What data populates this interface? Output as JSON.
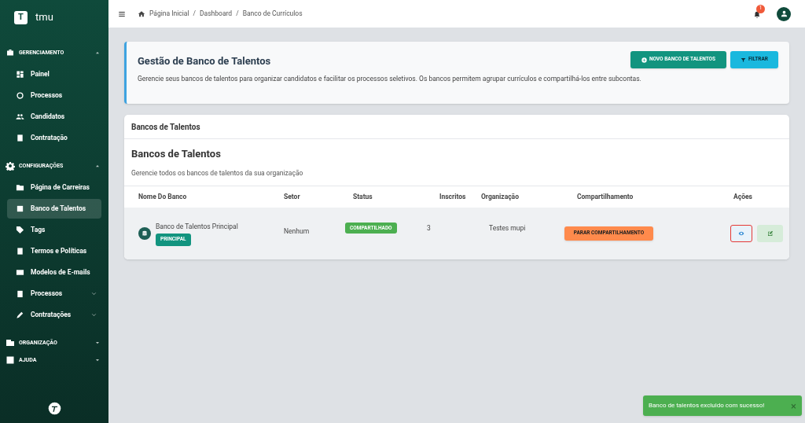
{
  "brand": {
    "logo_letter": "T",
    "name": "tmu"
  },
  "sidebar": {
    "sections": [
      {
        "label": "GERENCIAMENTO",
        "expanded": true,
        "items": [
          {
            "kind": "link",
            "label": "Painel",
            "selected": false
          },
          {
            "kind": "link",
            "label": "Processos",
            "selected": false
          },
          {
            "kind": "link",
            "label": "Candidatos",
            "selected": false
          },
          {
            "kind": "link",
            "label": "Contratação",
            "selected": false
          }
        ]
      },
      {
        "label": "CONFIGURAÇÕES",
        "expanded": true,
        "items": [
          {
            "kind": "link",
            "label": "Página de Carreiras",
            "selected": false
          },
          {
            "kind": "link",
            "label": "Banco de Talentos",
            "selected": true
          },
          {
            "kind": "link",
            "label": "Tags",
            "selected": false
          },
          {
            "kind": "link",
            "label": "Termos e Políticas",
            "selected": false
          },
          {
            "kind": "link",
            "label": "Modelos de E-mails",
            "selected": false
          },
          {
            "kind": "group",
            "label": "Processos",
            "selected": false,
            "expanded": false
          },
          {
            "kind": "group",
            "label": "Contratações",
            "selected": false,
            "expanded": false
          }
        ]
      },
      {
        "label": "ORGANIZAÇÃO",
        "expanded": false
      },
      {
        "label": "AJUDA",
        "expanded": false
      }
    ]
  },
  "topbar": {
    "breadcrumbs": [
      "Página Inicial",
      "Dashboard",
      "Banco de Currículos"
    ],
    "notification_count": "1",
    "separator": "/"
  },
  "header_card": {
    "title": "Gestão de Banco de Talentos",
    "description": "Gerencie seus bancos de talentos para organizar candidatos e facilitar os processos seletivos. Os bancos permitem agrupar currículos e compartilhá-los entre subcontas.",
    "buttons": [
      {
        "kind": "primary",
        "label": "NOVO BANCO DE TALENTOS"
      },
      {
        "kind": "filter",
        "label": "FILTRAR"
      }
    ]
  },
  "panel": {
    "title": "Bancos de Talentos",
    "heading": "Bancos de Talentos",
    "subtitle": "Gerencie todos os bancos de talentos da sua organização",
    "table": {
      "columns": [
        "Nome Do Banco",
        "Setor",
        "Status",
        "Inscritos",
        "Organização",
        "Compartilhamento",
        "Ações"
      ],
      "rows": [
        {
          "name": "Banco de Talentos Principal",
          "badge": "PRINCIPAL",
          "sector": "Nenhum",
          "status": "COMPARTILHADO",
          "subscribers": "3",
          "organization": "Testes mupi",
          "share_button": "PARAR COMPARTILHAMENTO",
          "view_highlighted": true
        }
      ]
    }
  },
  "toast": {
    "message": "Banco de talentos excluido com sucesso!",
    "close": "×"
  }
}
